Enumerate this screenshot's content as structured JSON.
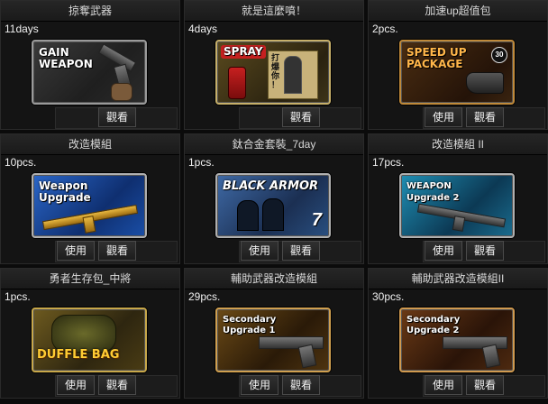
{
  "buttons": {
    "use": "使用",
    "view": "觀看"
  },
  "items": [
    {
      "title": "掠奪武器",
      "qty": "11days",
      "art_text": "GAIN\nWEAPON",
      "art_sub": "",
      "icon": "pistol-hand-icon",
      "has_use": false
    },
    {
      "title": "就是這麼噴！",
      "qty": "4days",
      "art_text": "SPRAY",
      "art_sub": "打\n爆\n你\n！",
      "icon": "spray-can-icon",
      "has_use": false
    },
    {
      "title": "加速up超值包",
      "qty": "2pcs.",
      "art_text": "SPEED UP\nPACKAGE",
      "art_sub": "30",
      "icon": "boot-icon",
      "has_use": true
    },
    {
      "title": "改造模組",
      "qty": "10pcs.",
      "art_text": "Weapon\nUpgrade",
      "art_sub": "",
      "icon": "gold-rifle-icon",
      "has_use": true
    },
    {
      "title": "鈦合金套裝_7day",
      "qty": "1pcs.",
      "art_text": "BLACK ARMOR",
      "art_sub": "7",
      "icon": "armor-soldiers-icon",
      "has_use": true
    },
    {
      "title": "改造模組 II",
      "qty": "17pcs.",
      "art_text": "WEAPON\nUpgrade 2",
      "art_sub": "",
      "icon": "rifle-icon",
      "has_use": true
    },
    {
      "title": "勇者生存包_中將",
      "qty": "1pcs.",
      "art_text": "DUFFLE BAG",
      "art_sub": "",
      "icon": "duffle-bag-icon",
      "has_use": true
    },
    {
      "title": "輔助武器改造模組",
      "qty": "29pcs.",
      "art_text": "Secondary\nUpgrade 1",
      "art_sub": "",
      "icon": "pistol-icon",
      "has_use": true
    },
    {
      "title": "輔助武器改造模組II",
      "qty": "30pcs.",
      "art_text": "Secondary\nUpgrade 2",
      "art_sub": "",
      "icon": "pistol-icon",
      "has_use": true
    }
  ]
}
